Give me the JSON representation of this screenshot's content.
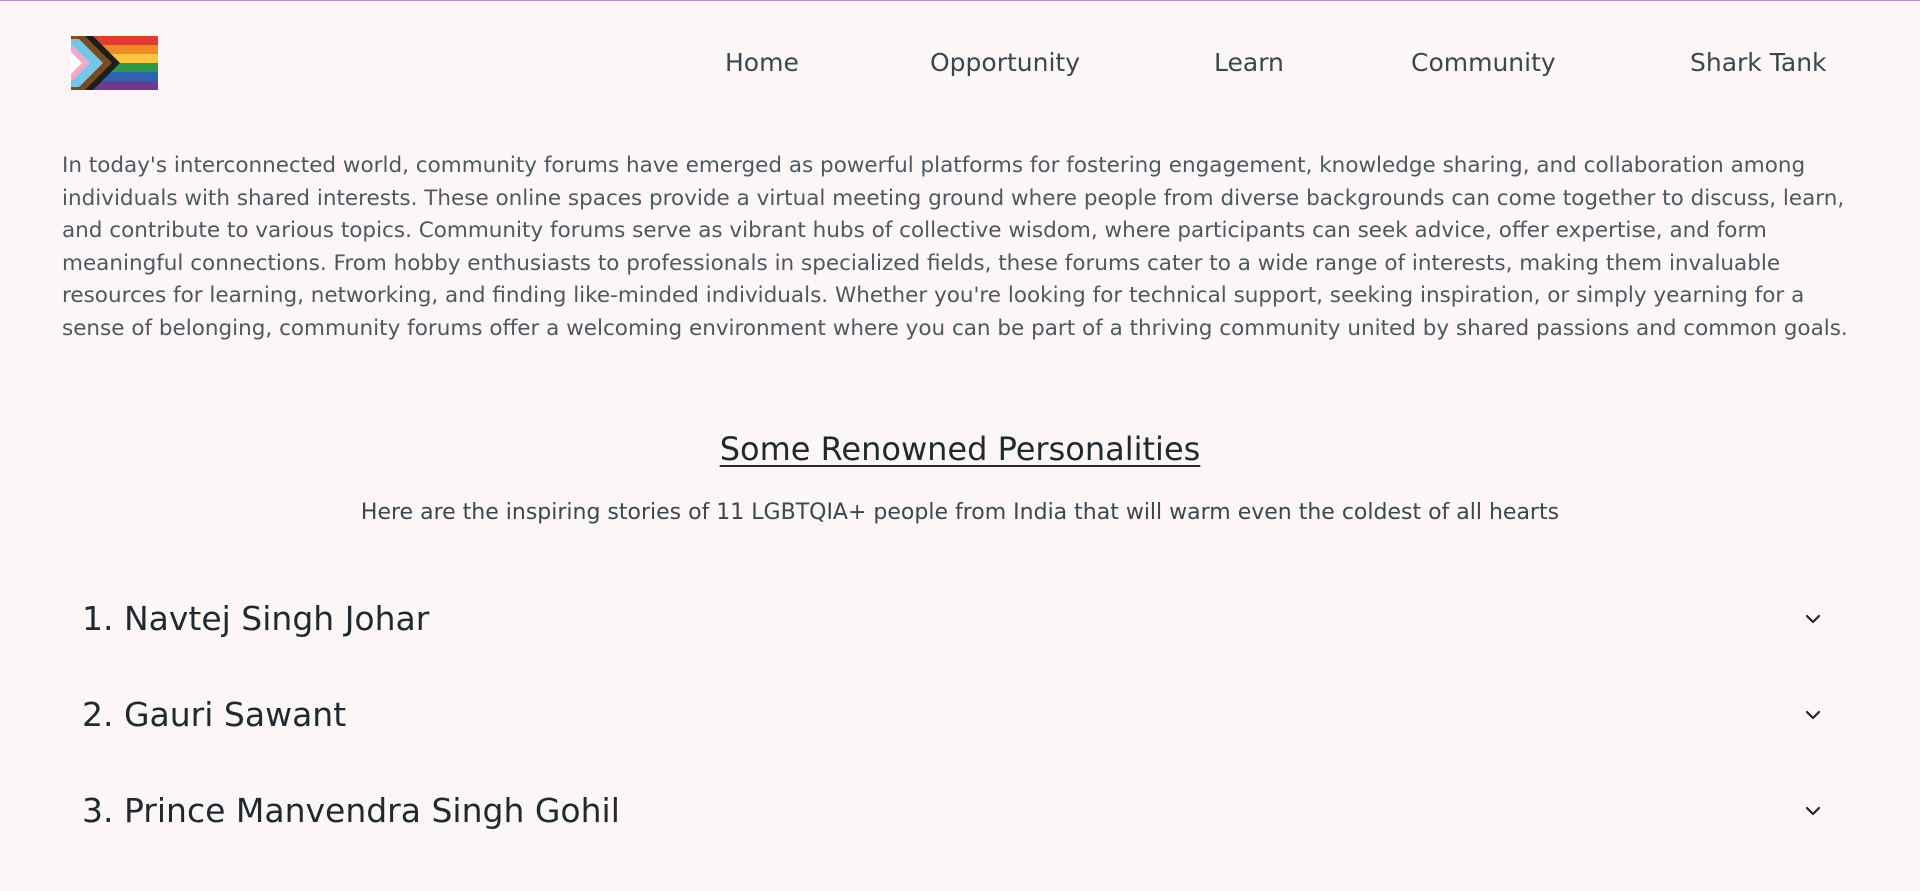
{
  "header": {
    "logo_icon": "progress-pride-flag-icon",
    "nav": [
      {
        "label": "Home"
      },
      {
        "label": "Opportunity"
      },
      {
        "label": "Learn"
      },
      {
        "label": "Community"
      },
      {
        "label": "Shark Tank"
      }
    ]
  },
  "intro": {
    "text": "In today's interconnected world, community forums have emerged as powerful platforms for fostering engagement, knowledge sharing, and collaboration among individuals with shared interests. These online spaces provide a virtual meeting ground where people from diverse backgrounds can come together to discuss, learn, and contribute to various topics. Community forums serve as vibrant hubs of collective wisdom, where participants can seek advice, offer expertise, and form meaningful connections. From hobby enthusiasts to professionals in specialized fields, these forums cater to a wide range of interests, making them invaluable resources for learning, networking, and finding like-minded individuals. Whether you're looking for technical support, seeking inspiration, or simply yearning for a sense of belonging, community forums offer a welcoming environment where you can be part of a thriving community united by shared passions and common goals."
  },
  "personalities": {
    "title": "Some Renowned Personalities",
    "subtitle": "Here are the inspiring stories of 11 LGBTQIA+ people from India that will warm even the coldest of all hearts",
    "items": [
      {
        "label": "1. Navtej Singh Johar"
      },
      {
        "label": "2. Gauri Sawant"
      },
      {
        "label": "3. Prince Manvendra Singh Gohil"
      }
    ],
    "expand_icon": "chevron-down-icon"
  },
  "colors": {
    "background": "#fcf6f6",
    "text": "#3a4750",
    "heading": "#1f2a30",
    "top_border": "#b58ad6"
  }
}
